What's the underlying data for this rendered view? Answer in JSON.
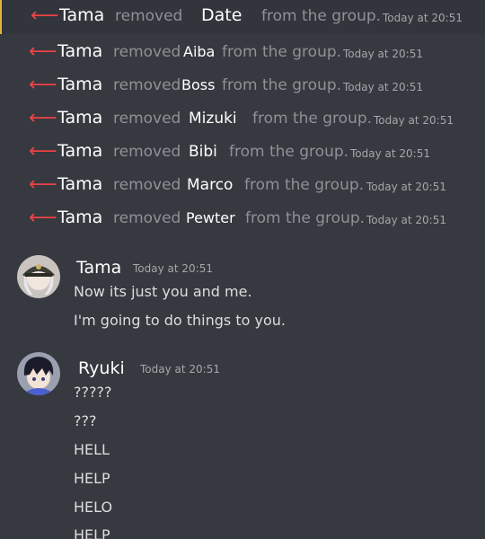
{
  "system_messages": [
    {
      "actor": "Tama",
      "action": "removed",
      "target": "Date",
      "suffix": "from the group.",
      "time": "Today at 20:51"
    },
    {
      "actor": "Tama",
      "action": "removed",
      "target": "Aiba",
      "suffix": "from the group.",
      "time": "Today at 20:51"
    },
    {
      "actor": "Tama",
      "action": "removed",
      "target": "Boss",
      "suffix": "from the group.",
      "time": "Today at 20:51"
    },
    {
      "actor": "Tama",
      "action": "removed",
      "target": "Mizuki",
      "suffix": "from the group.",
      "time": "Today at 20:51"
    },
    {
      "actor": "Tama",
      "action": "removed",
      "target": "Bibi",
      "suffix": "from the group.",
      "time": "Today at 20:51"
    },
    {
      "actor": "Tama",
      "action": "removed",
      "target": "Marco",
      "suffix": "from the group.",
      "time": "Today at 20:51"
    },
    {
      "actor": "Tama",
      "action": "removed",
      "target": "Pewter",
      "suffix": "from the group.",
      "time": "Today at 20:51"
    }
  ],
  "messages": [
    {
      "author": "Tama",
      "time": "Today at 20:51",
      "lines": [
        "Now its just you and me.",
        "I'm going to do things to you."
      ]
    },
    {
      "author": "Ryuki",
      "time": "Today at 20:51",
      "lines": [
        "?????",
        "???",
        "HELL",
        "HELP",
        "HELO",
        "HELP"
      ]
    }
  ],
  "colors": {
    "background": "#36393f",
    "arrow_red": "#ed4245",
    "muted_text": "#8e9297",
    "highlight_bar": "#e0b43a"
  },
  "icons": {
    "arrow": "arrow-left-icon"
  }
}
